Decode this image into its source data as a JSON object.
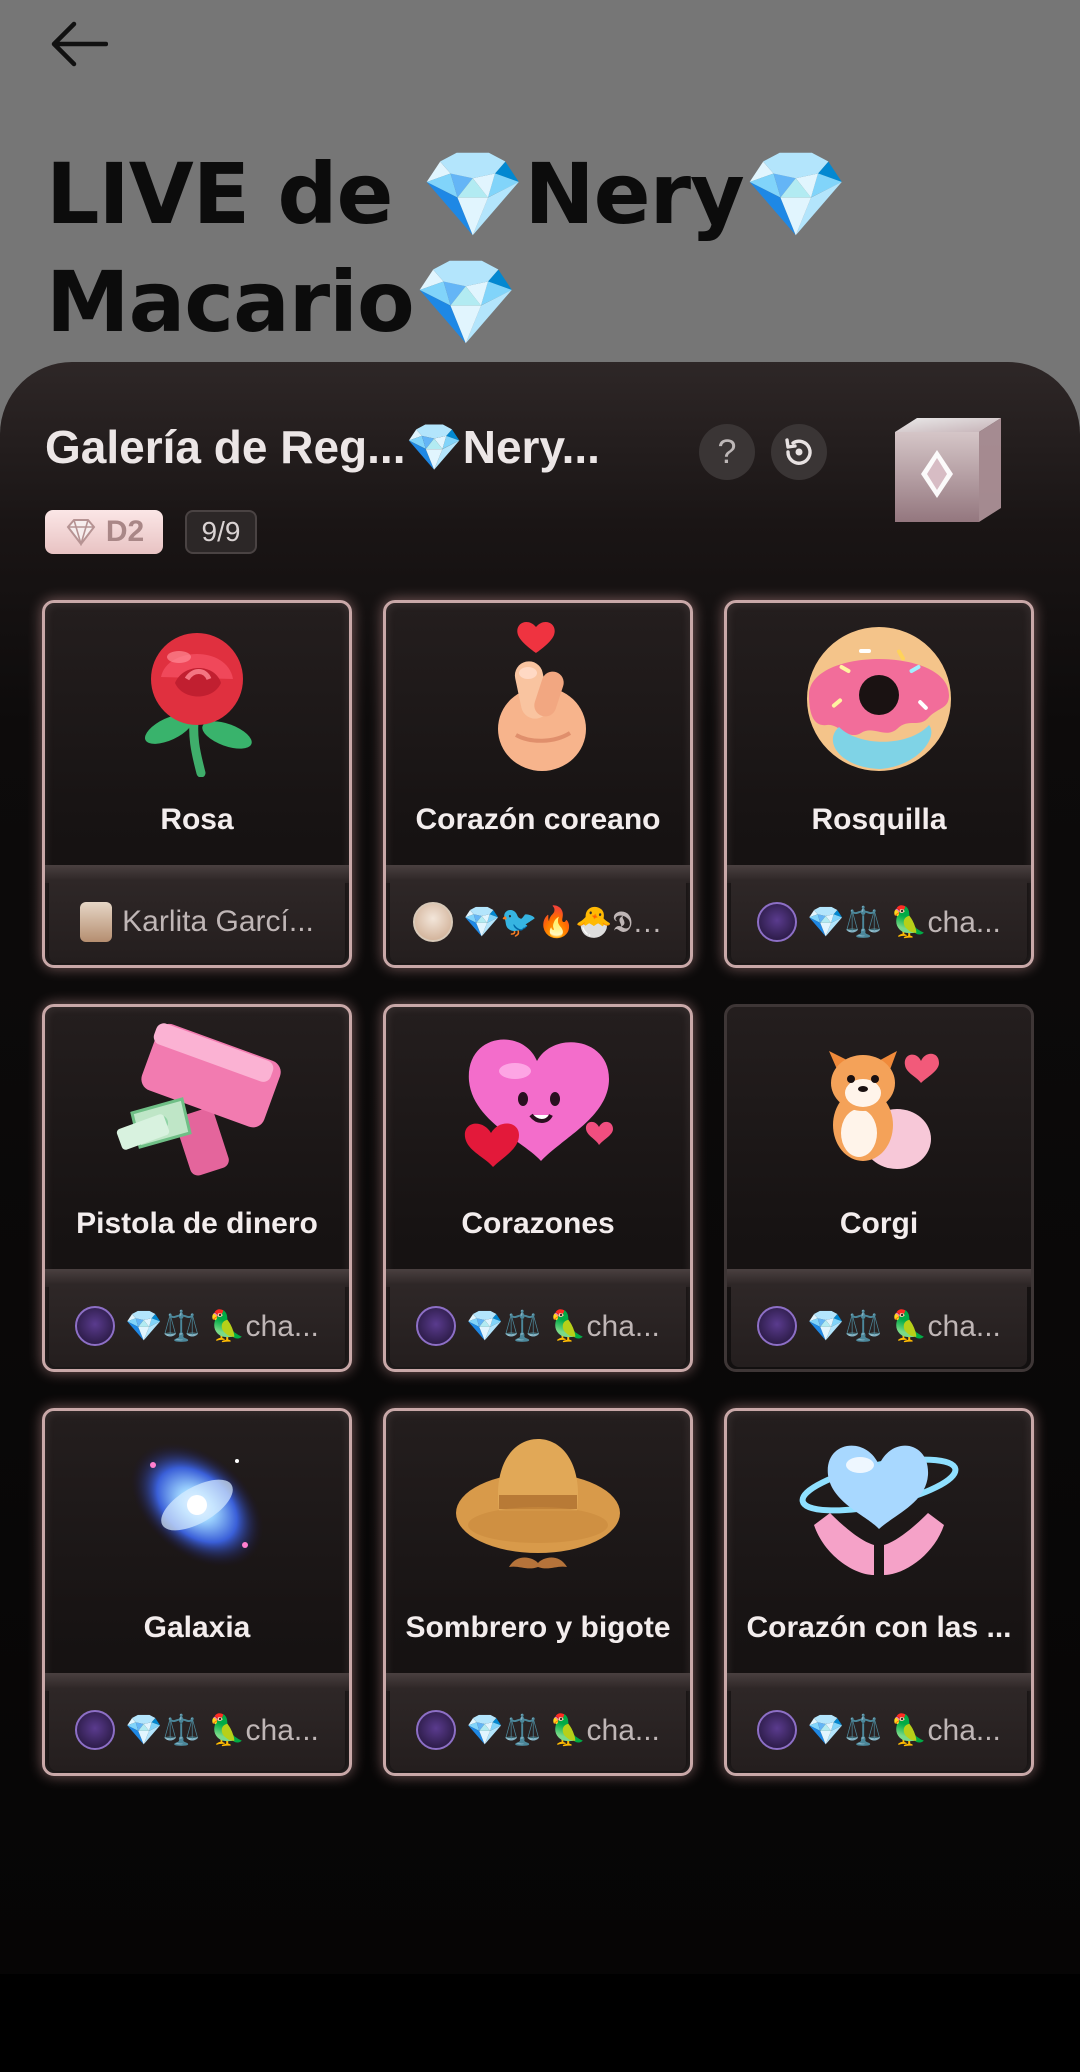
{
  "header": {
    "back_icon": "arrow-left-icon",
    "live_title": "LIVE de 💎Nery💎 Macario💎"
  },
  "sheet": {
    "title": "Galería de Reg...💎Nery...",
    "help_label": "?",
    "level_label": "D2",
    "count_label": "9/9"
  },
  "gifts": [
    {
      "name": "Rosa",
      "sender": "Karlita Garcí...",
      "icon": "rose-icon"
    },
    {
      "name": "Corazón coreano",
      "sender": "💎🐦🔥🐣𝕯j...",
      "icon": "finger-heart-icon"
    },
    {
      "name": "Rosquilla",
      "sender": "💎⚖️ 🦜cha...",
      "icon": "donut-icon"
    },
    {
      "name": "Pistola de dinero",
      "sender": "💎⚖️ 🦜cha...",
      "icon": "money-gun-icon"
    },
    {
      "name": "Corazones",
      "sender": "💎⚖️ 🦜cha...",
      "icon": "hearts-icon"
    },
    {
      "name": "Corgi",
      "sender": "💎⚖️ 🦜cha...",
      "icon": "corgi-icon"
    },
    {
      "name": "Galaxia",
      "sender": "💎⚖️ 🦜cha...",
      "icon": "galaxy-icon"
    },
    {
      "name": "Sombrero y bigote",
      "sender": "💎⚖️ 🦜cha...",
      "icon": "hat-mustache-icon"
    },
    {
      "name": "Corazón con las ...",
      "sender": "💎⚖️ 🦜cha...",
      "icon": "heart-in-hands-icon"
    }
  ],
  "colors": {
    "backdrop": "#767676",
    "sheet": "#0d0b0b",
    "card_glow": "#c9a8a8",
    "level_badge": "#f5d9d9"
  }
}
